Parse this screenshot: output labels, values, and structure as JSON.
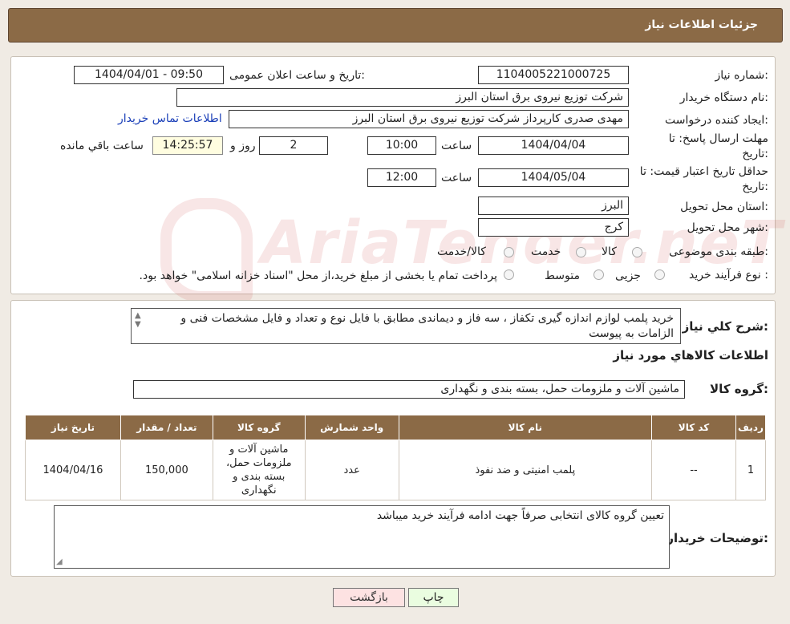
{
  "page_title": "جزئیات اطلاعات نیاز",
  "form": {
    "need_number_label": "شماره نیاز:",
    "need_number": "1104005221000725",
    "announce_label": "تاریخ و ساعت اعلان عمومی:",
    "announce_value": "1404/04/01 - 09:50",
    "buyer_org_label": "نام دستگاه خریدار:",
    "buyer_org": "شرکت توزیع نیروی برق استان البرز",
    "creator_label": "ایجاد کننده درخواست:",
    "creator": "مهدی صدری کارپرداز شرکت توزیع نیروی برق استان البرز",
    "contact_link": "اطلاعات تماس خریدار",
    "reply_deadline_label_1": "مهلت ارسال پاسخ: تا",
    "reply_deadline_label_2": "تاریخ:",
    "reply_date": "1404/04/04",
    "time_label": "ساعت",
    "reply_time": "10:00",
    "days_value": "2",
    "days_label": "روز و",
    "remaining_time": "14:25:57",
    "remaining_label": "ساعت باقي مانده",
    "validity_label_1": "حداقل تاریخ اعتبار قیمت: تا",
    "validity_label_2": "تاریخ:",
    "validity_date": "1404/05/04",
    "validity_time": "12:00",
    "province_label": "استان محل تحویل:",
    "province": "البرز",
    "city_label": "شهر محل تحویل:",
    "city": "کرج",
    "category_label": "طبقه بندی موضوعی:",
    "category_options": [
      "کالا",
      "خدمت",
      "کالا/خدمت"
    ],
    "purchase_type_label": "نوع فرآیند خرید :",
    "purchase_type_options": [
      "جزیی",
      "متوسط"
    ],
    "purchase_note": "پرداخت تمام یا بخشی از مبلغ خرید،از محل \"اسناد خزانه اسلامی\" خواهد بود."
  },
  "details": {
    "description_label": "شرح کلي نياز:",
    "description": "خرید پلمب لوازم اندازه گیری تکفاز ، سه فاز و دیماندی  مطابق با فایل نوع و تعداد و فایل مشخصات فنی و الزامات به پیوست",
    "goods_info_title": "اطلاعات کالاهاي مورد نياز",
    "goods_group_label": "گروه کالا:",
    "goods_group": "ماشین آلات و ملزومات حمل، بسته بندی و نگهداری"
  },
  "table": {
    "headers": [
      "رديف",
      "کد کالا",
      "نام کالا",
      "واحد شمارش",
      "گروه کالا",
      "تعداد / مقدار",
      "تاريخ نياز"
    ],
    "rows": [
      {
        "row": "1",
        "code": "--",
        "name": "پلمب امنیتی و ضد نفوذ",
        "unit": "عدد",
        "group": "ماشین آلات و ملزومات حمل، بسته بندی و نگهداری",
        "quantity": "150,000",
        "date": "1404/04/16"
      }
    ]
  },
  "buyer_notes_label": "توضیحات خریدار:",
  "buyer_notes": "تعیین گروه کالای انتخابی صرفاً جهت ادامه فرآیند خرید میباشد",
  "buttons": {
    "print": "چاپ",
    "back": "بازگشت"
  },
  "colors": {
    "header_bg": "#8b6a46",
    "print_bg": "#eafde0",
    "back_bg": "#fde2e2",
    "link": "#1a3fb8"
  }
}
